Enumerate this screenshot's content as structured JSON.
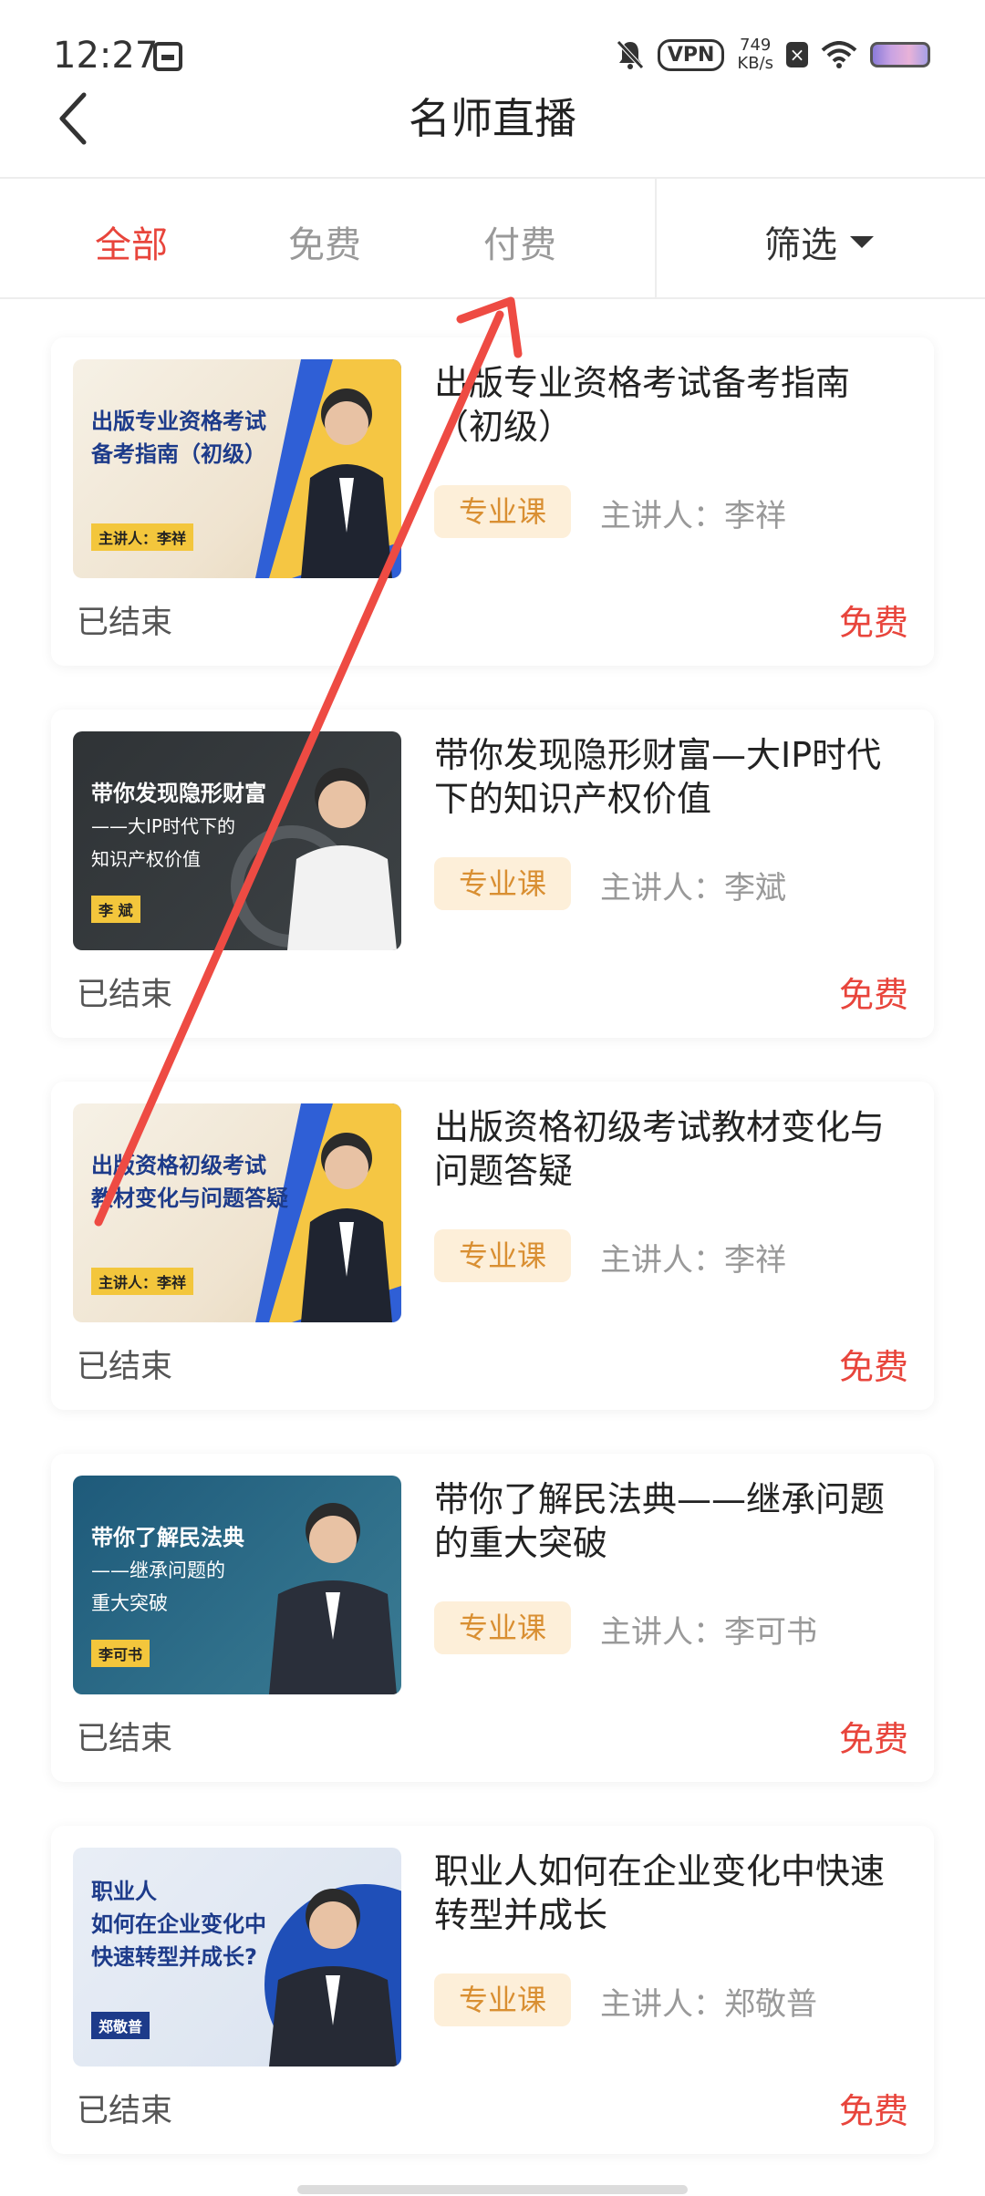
{
  "status_bar": {
    "time": "12:27",
    "vpn": "VPN",
    "speed_value": "749",
    "speed_unit": "KB/s"
  },
  "header": {
    "title": "名师直播"
  },
  "tabs": {
    "all": "全部",
    "free": "免费",
    "paid": "付费",
    "filter": "筛选"
  },
  "courses": [
    {
      "title": "出版专业资格考试备考指南（初级）",
      "tag": "专业课",
      "host": "主讲人：李祥",
      "status": "已结束",
      "price": "免费",
      "thumb": {
        "line1": "出版专业资格考试",
        "line2": "备考指南（初级）",
        "label": "主讲人：李祥"
      }
    },
    {
      "title": "带你发现隐形财富—大IP时代下的知识产权价值",
      "tag": "专业课",
      "host": "主讲人：李斌",
      "status": "已结束",
      "price": "免费",
      "thumb": {
        "line1": "带你发现隐形财富",
        "line2": "——大IP时代下的",
        "line3": "知识产权价值",
        "label": "李 斌"
      }
    },
    {
      "title": "出版资格初级考试教材变化与问题答疑",
      "tag": "专业课",
      "host": "主讲人：李祥",
      "status": "已结束",
      "price": "免费",
      "thumb": {
        "line1": "出版资格初级考试",
        "line2": "教材变化与问题答疑",
        "label": "主讲人：李祥"
      }
    },
    {
      "title": "带你了解民法典——继承问题的重大突破",
      "tag": "专业课",
      "host": "主讲人：李可书",
      "status": "已结束",
      "price": "免费",
      "thumb": {
        "line1": "带你了解民法典",
        "line2": "——继承问题的",
        "line3": "重大突破",
        "label": "李可书"
      }
    },
    {
      "title": "职业人如何在企业变化中快速转型并成长",
      "tag": "专业课",
      "host": "主讲人：郑敬普",
      "status": "已结束",
      "price": "免费",
      "thumb": {
        "line1": "职业人",
        "line2": "如何在企业变化中",
        "line3": "快速转型并成长?",
        "label": "郑敬普"
      }
    }
  ],
  "colors": {
    "accent": "#e8453c",
    "tag_bg": "#fdefd9",
    "tag_text": "#d98f32",
    "annotation_arrow": "#ee4b43"
  }
}
